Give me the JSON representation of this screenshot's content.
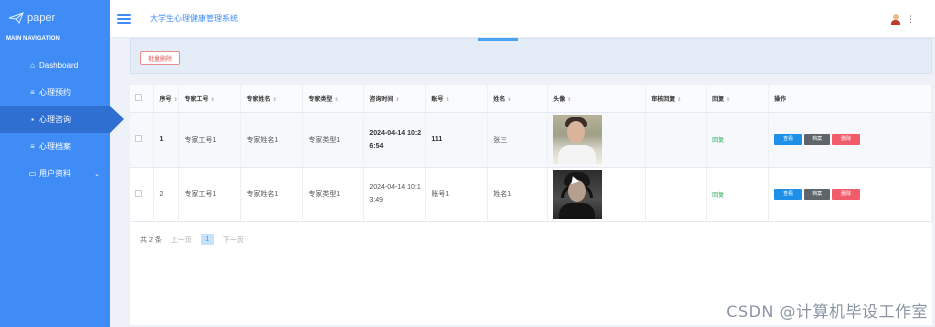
{
  "sidebar": {
    "logo_text": "paper",
    "section_header": "MAIN NAVIGATION",
    "items": [
      {
        "label": "Dashboard",
        "icon": "home-icon"
      },
      {
        "label": "心理预约",
        "icon": "list-icon"
      },
      {
        "label": "心理咨询",
        "icon": "grid-icon",
        "active": true
      },
      {
        "label": "心理档案",
        "icon": "list-icon"
      },
      {
        "label": "用户资料",
        "icon": "card-icon",
        "expandable": true
      }
    ]
  },
  "header": {
    "title": "大学生心理健康管理系统",
    "more_glyph": "⋮"
  },
  "toolbar": {
    "batch_delete_label": "批量删除"
  },
  "table": {
    "columns": [
      "序号",
      "专家工号",
      "专家姓名",
      "专家类型",
      "咨询时间",
      "账号",
      "姓名",
      "头像",
      "审核回复",
      "回复",
      "操作"
    ],
    "rows": [
      {
        "index": "1",
        "expert_no": "专家工号1",
        "expert_name": "专家姓名1",
        "expert_type": "专家类型1",
        "consult_time": "2024-04-14 10:26:54",
        "account": "111",
        "name": "张三",
        "review_reply": "",
        "reply": "回复"
      },
      {
        "index": "2",
        "expert_no": "专家工号1",
        "expert_name": "专家姓名1",
        "expert_type": "专家类型1",
        "consult_time": "2024-04-14 10:13:49",
        "account": "账号1",
        "name": "姓名1",
        "review_reply": "",
        "reply": "回复"
      }
    ],
    "actions": {
      "view": "查看",
      "archive": "档案",
      "delete": "删除"
    }
  },
  "pagination": {
    "total": "共 2 条",
    "prev": "上一页",
    "current": "1",
    "next": "下一页"
  },
  "watermark": "CSDN @计算机毕设工作室",
  "colors": {
    "sidebar": "#3f8cf6",
    "sidebar_active": "#2f6fd2",
    "view_button": "#1e90e8",
    "archive_button": "#5e6469",
    "delete_button": "#f05c6a",
    "reply_link": "#2eab5b"
  }
}
